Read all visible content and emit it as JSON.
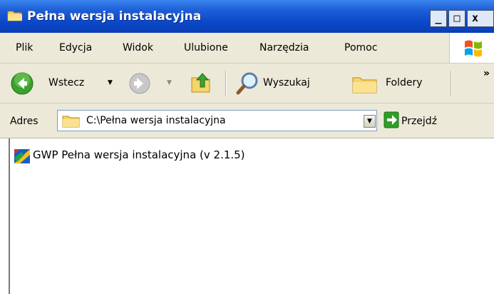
{
  "window": {
    "title": "Pełna wersja instalacyjna",
    "controls": {
      "minimize": "_",
      "maximize": "□",
      "close": "x"
    }
  },
  "menu": [
    "Plik",
    "Edycja",
    "Widok",
    "Ulubione",
    "Narzędzia",
    "Pomoc"
  ],
  "toolbar": {
    "back_label": "Wstecz",
    "search_label": "Wyszukaj",
    "folders_label": "Foldery",
    "more": "»"
  },
  "address": {
    "label": "Adres",
    "value": "C:\\Pełna wersja instalacyjna",
    "go_label": "Przejdź"
  },
  "files": [
    {
      "name": "GWP Pełna wersja instalacyjna (v 2.1.5)",
      "icon": "gwp-app-icon"
    }
  ],
  "colors": {
    "titlebar": "#0a47c9",
    "chrome": "#ece9d8",
    "back_green": "#3aa12a",
    "go_green": "#2f9e26"
  }
}
